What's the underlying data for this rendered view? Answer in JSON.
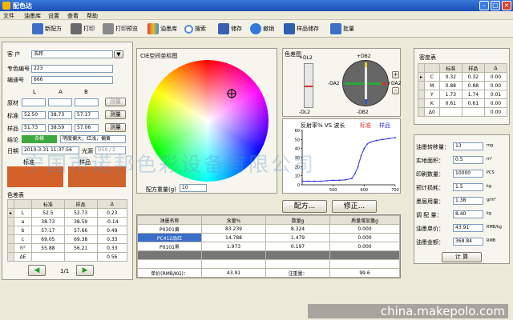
{
  "window": {
    "title": "配色达"
  },
  "menu": [
    "文件",
    "油墨库",
    "设置",
    "查看",
    "帮助"
  ],
  "toolbar": [
    {
      "label": "新配方",
      "icon": "new-recipe-icon",
      "color": "#3b6fc9"
    },
    {
      "label": "打印",
      "icon": "print-icon",
      "color": "#6a6a6a"
    },
    {
      "label": "打印预览",
      "icon": "print-preview-icon",
      "color": "#8a8a8a"
    },
    {
      "label": "油墨库",
      "icon": "ink-library-icon",
      "color": "#d83a3a"
    },
    {
      "label": "搜索",
      "icon": "search-icon",
      "color": "#5a8ad8"
    },
    {
      "label": "储存",
      "icon": "save-icon",
      "color": "#3b5fb0"
    },
    {
      "label": "撤销",
      "icon": "undo-icon",
      "color": "#2f7ad8"
    },
    {
      "label": "样品储存",
      "icon": "sample-save-icon",
      "color": "#2f5fb0"
    },
    {
      "label": "批量",
      "icon": "batch-icon",
      "color": "#3b6fc9"
    }
  ],
  "customer": {
    "label": "客  户",
    "value": "浩邦"
  },
  "special_color_no": {
    "label": "专色编号",
    "value": "223"
  },
  "ink_no": {
    "label": "编通号",
    "value": "666"
  },
  "lab": {
    "headers": [
      "L",
      "A",
      "B"
    ],
    "rows": [
      {
        "label": "原材",
        "values": [
          "",
          "",
          ""
        ],
        "button": "测量"
      },
      {
        "label": "标准",
        "values": [
          "52.50",
          "38.73",
          "57.17"
        ],
        "button": "测量"
      },
      {
        "label": "样品",
        "values": [
          "51.73",
          "38.59",
          "57.06"
        ],
        "button": "测量"
      }
    ]
  },
  "conclusion": {
    "label": "结论",
    "badge": "合格",
    "badge_color": "#3fa83f",
    "text": "明度偏大，红浅，偏黄"
  },
  "date": {
    "label": "日期",
    "value": "2010-3-31 11:37:56",
    "light_label": "光源",
    "light_value": "D50 / 2"
  },
  "swatches": {
    "standard_label": "标准",
    "sample_label": "样品",
    "standard_color": "#d4602a",
    "sample_color": "#d0622c"
  },
  "color_diff_table": {
    "title": "色差表",
    "headers": [
      "",
      "标准",
      "样品",
      "Δ"
    ],
    "rows": [
      [
        "L",
        "52.5",
        "52.73",
        "0.23"
      ],
      [
        "a",
        "38.73",
        "38.59",
        "-0.14"
      ],
      [
        "b",
        "57.17",
        "57.66",
        "0.49"
      ],
      [
        "c",
        "69.05",
        "69.38",
        "0.33"
      ],
      [
        "h°",
        "55.88",
        "56.21",
        "0.33"
      ],
      [
        "ΔE",
        "",
        "",
        "0.56"
      ]
    ]
  },
  "pager": {
    "text": "1/1"
  },
  "cie_panel": {
    "title": "CIE空间坐标图"
  },
  "recipe_weight": {
    "label": "配方重量(g)",
    "value": "10"
  },
  "color_diff_chart": {
    "title": "色差图",
    "l_top": "+DL2",
    "l_bottom": "-DL2",
    "a_left": "-DA2",
    "a_right": "+DA2",
    "b_top": "+DB2",
    "b_bottom": "-DB2",
    "plus": "+",
    "minus": "-"
  },
  "density_table": {
    "title": "密度表",
    "headers": [
      "",
      "标准",
      "样品",
      "Δ"
    ],
    "rows": [
      [
        "C",
        "0.32",
        "0.32",
        "0.00"
      ],
      [
        "M",
        "0.88",
        "0.88",
        "0.00"
      ],
      [
        "Y",
        "1.73",
        "1.74",
        "0.01"
      ],
      [
        "K",
        "0.61",
        "0.61",
        "0.00"
      ],
      [
        "Δ0",
        "",
        "",
        "0.00"
      ]
    ]
  },
  "chart_data": {
    "type": "line",
    "title": "反射率% VS 波长",
    "legend": [
      {
        "name": "标准",
        "color": "#e03030"
      },
      {
        "name": "样品",
        "color": "#3030e0"
      }
    ],
    "xlim": [
      400,
      700
    ],
    "ylim": [
      0,
      60
    ],
    "xticks": [
      500,
      600,
      700
    ],
    "yticks": [
      0,
      10,
      20,
      30,
      40,
      50,
      60
    ],
    "grid": false,
    "series": [
      {
        "name": "样品",
        "color": "#3030d0",
        "x": [
          400,
          420,
          440,
          460,
          480,
          500,
          520,
          540,
          560,
          570,
          580,
          590,
          600,
          610,
          620,
          640,
          660,
          680,
          700
        ],
        "y": [
          4,
          4,
          4,
          4,
          4.5,
          5,
          5,
          5.5,
          7,
          12,
          20,
          32,
          40,
          45,
          47,
          49,
          50,
          51,
          52
        ]
      }
    ]
  },
  "buttons": {
    "recipe": "配方...",
    "correct": "修正..."
  },
  "recipe_table": {
    "headers": [
      "油墨名称",
      "含量%",
      "数量g",
      "质量增加量g"
    ],
    "rows": [
      [
        "P0301黄",
        "83.239",
        "8.324",
        "0.000"
      ],
      [
        "PC412品红",
        "14.788",
        "1.479",
        "0.000"
      ],
      [
        "P0101黑",
        "1.973",
        "0.197",
        "0.000"
      ],
      [
        "",
        "",
        "",
        ""
      ],
      [
        "",
        "",
        "",
        ""
      ]
    ],
    "footer": {
      "unit_price_label": "单价(RMB/KG)：",
      "unit_price": "43.91",
      "total_label": "注重量：",
      "total": "99.6"
    }
  },
  "calc_panel": {
    "rows": [
      {
        "label": "油墨转移量：",
        "value": "13",
        "unit": "mg"
      },
      {
        "label": "实地面积：",
        "value": "0.5",
        "unit": "m²"
      },
      {
        "label": "印刷数量：",
        "value": "10000",
        "unit": "PCS"
      },
      {
        "label": "预计损耗：",
        "value": "1.5",
        "unit": "kg"
      },
      {
        "label": "墨层用量：",
        "value": "1.38",
        "unit": "g/m²"
      },
      {
        "label": "调 配 量：",
        "value": "8.40",
        "unit": "kg"
      },
      {
        "label": "油墨单价：",
        "value": "43.91",
        "unit": "RMB/kg"
      },
      {
        "label": "油墨金额：",
        "value": "368.84",
        "unit": "RMB"
      }
    ],
    "button": "计  算"
  },
  "watermark": {
    "text": "宁国市诺邦色彩设备有限公司",
    "site": "china.makepolo.com"
  }
}
